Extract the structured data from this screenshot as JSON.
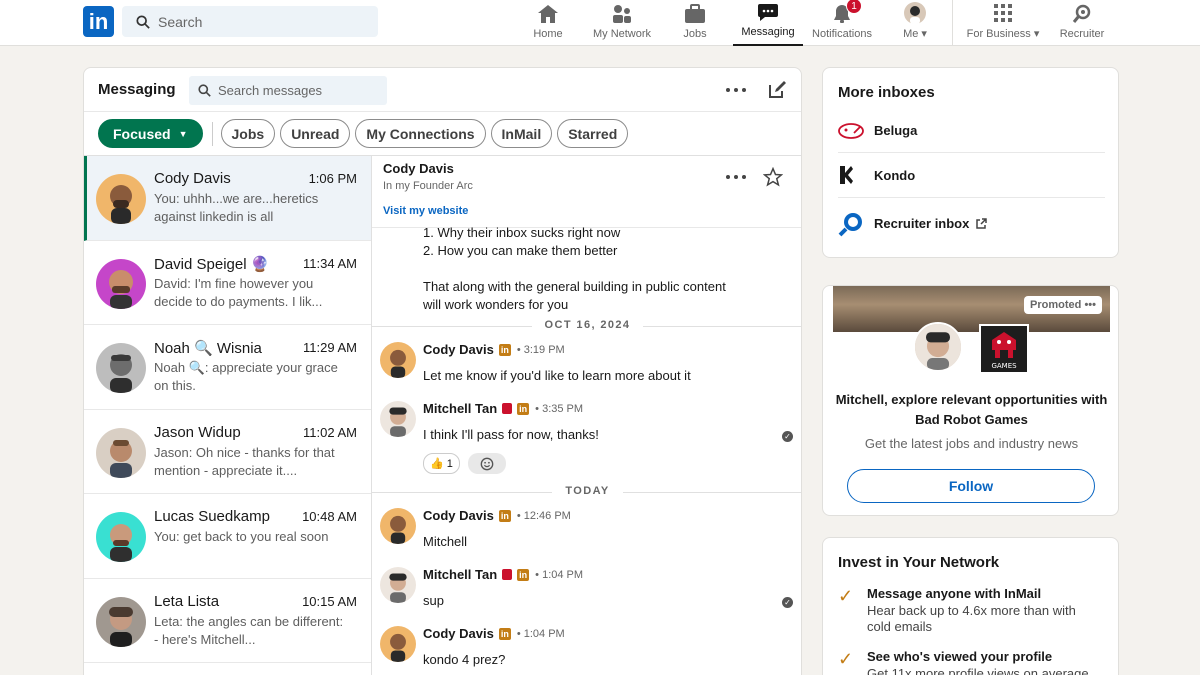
{
  "topnav": {
    "logo_text": "in",
    "search_placeholder": "Search",
    "items": [
      {
        "label": "Home",
        "icon": "home-icon"
      },
      {
        "label": "My Network",
        "icon": "network-icon"
      },
      {
        "label": "Jobs",
        "icon": "briefcase-icon"
      },
      {
        "label": "Messaging",
        "icon": "messaging-icon",
        "active": true
      },
      {
        "label": "Notifications",
        "icon": "bell-icon",
        "badge": "1"
      },
      {
        "label": "Me",
        "icon": "profile-icon"
      },
      {
        "label": "For Business",
        "icon": "grid-icon"
      },
      {
        "label": "Recruiter",
        "icon": "recruiter-icon"
      }
    ]
  },
  "messaging": {
    "title": "Messaging",
    "search_placeholder": "Search messages",
    "filters": [
      "Focused",
      "Jobs",
      "Unread",
      "My Connections",
      "InMail",
      "Starred"
    ],
    "conversations": [
      {
        "name": "Cody Davis",
        "time": "1:06 PM",
        "preview": "You: uhhh...we are...heretics against linkedin is all",
        "selected": true
      },
      {
        "name": "David Speigel 🔮",
        "time": "11:34 AM",
        "preview": "David: I'm fine however you decide to do payments. I lik..."
      },
      {
        "name": "Noah 🔍 Wisnia",
        "time": "11:29 AM",
        "preview": "Noah 🔍: appreciate your grace on this."
      },
      {
        "name": "Jason Widup",
        "time": "11:02 AM",
        "preview": "Jason: Oh nice - thanks for that mention - appreciate it...."
      },
      {
        "name": "Lucas Suedkamp",
        "time": "10:48 AM",
        "preview": "You: get back to you real soon"
      },
      {
        "name": "Leta Lista",
        "time": "10:15 AM",
        "preview": "Leta: the angles can be different:  - here's Mitchell..."
      }
    ]
  },
  "thread": {
    "name": "Cody Davis",
    "subtitle": "In my Founder Arc",
    "link": "Visit my website",
    "lines": [
      "1. Why their inbox sucks right now",
      "2. How you can make them better",
      "That along with the general building in public content",
      "will work wonders for you"
    ],
    "date1": "OCT 16, 2024",
    "date2": "TODAY",
    "messages": [
      {
        "sender": "Cody Davis",
        "time": "3:19 PM",
        "text": "Let me know if you'd like to learn more about it"
      },
      {
        "sender": "Mitchell Tan",
        "time": "3:35 PM",
        "text": "I think I'll pass for now, thanks!",
        "reaction": "👍 1"
      },
      {
        "sender": "Cody Davis",
        "time": "12:46 PM",
        "text": "Mitchell"
      },
      {
        "sender": "Mitchell Tan",
        "time": "1:04 PM",
        "text": "sup"
      },
      {
        "sender": "Cody Davis",
        "time": "1:04 PM",
        "text": "kondo 4 prez?"
      }
    ]
  },
  "inboxes": {
    "title": "More inboxes",
    "items": [
      "Beluga",
      "Kondo",
      "Recruiter inbox"
    ]
  },
  "promo": {
    "label": "Promoted",
    "logo_text": "GAMES",
    "title": "Mitchell, explore relevant opportunities with Bad Robot Games",
    "subtitle": "Get the latest jobs and industry news",
    "button": "Follow"
  },
  "invest": {
    "title": "Invest in Your Network",
    "tips": [
      {
        "title": "Message anyone with InMail",
        "desc": "Hear back up to 4.6x more than with cold emails"
      },
      {
        "title": "See who's viewed your profile",
        "desc": "Get 11x more profile views on average"
      }
    ]
  },
  "colors": {
    "brand": "#0a66c2",
    "focused_green": "#01754f",
    "badge_red": "#cb112d",
    "premium_gold": "#c37d16"
  }
}
